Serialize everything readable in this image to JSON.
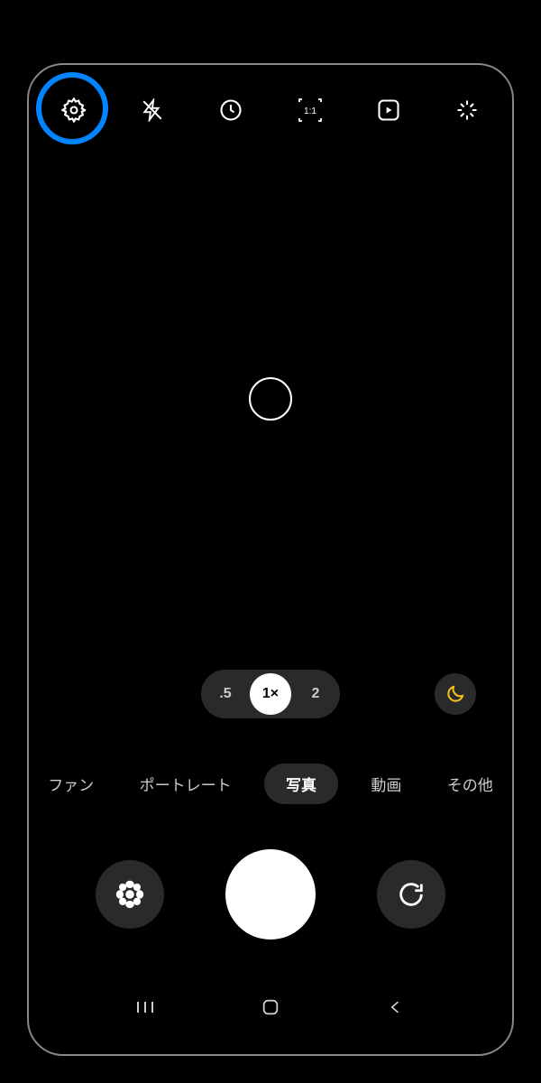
{
  "topbar": {
    "icons": [
      "settings",
      "flash",
      "timer",
      "ratio",
      "motion",
      "effects"
    ],
    "ratio_label": "1:1"
  },
  "zoom": {
    "options": [
      ".5",
      "1×",
      "2"
    ],
    "active_index": 1
  },
  "modes": {
    "items": [
      "ファン",
      "ポートレート",
      "写真",
      "動画",
      "その他"
    ],
    "active_index": 2
  },
  "controls": {
    "gallery": "gallery",
    "shutter": "shutter",
    "switch": "switch-camera"
  }
}
